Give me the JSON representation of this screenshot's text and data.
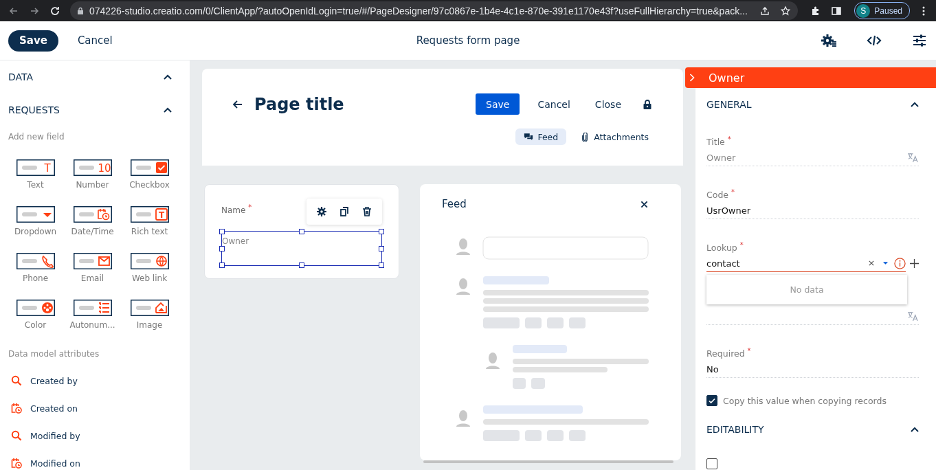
{
  "browser": {
    "url": "074226-studio.creatio.com/0/ClientApp/?autoOpenIdLogin=true/#/PageDesigner/97c0867e-1b4e-4c1e-870e-391e1170e43f?useFullHierarchy=true&pack...",
    "profile_initial": "S",
    "profile_status": "Paused"
  },
  "toolbar": {
    "save": "Save",
    "cancel": "Cancel",
    "title": "Requests form page"
  },
  "left": {
    "data_section": {
      "title": "DATA",
      "expanded": true
    },
    "requests_section": {
      "title": "REQUESTS",
      "expanded": true,
      "add_field_label": "Add new field",
      "field_types": [
        {
          "label": "Text",
          "kind": "text",
          "glyph": "T"
        },
        {
          "label": "Number",
          "kind": "number",
          "glyph": "10"
        },
        {
          "label": "Checkbox",
          "kind": "checkbox"
        },
        {
          "label": "Dropdown",
          "kind": "dropdown"
        },
        {
          "label": "Date/Time",
          "kind": "datetime"
        },
        {
          "label": "Rich text",
          "kind": "richtext",
          "glyph": "T"
        },
        {
          "label": "Phone",
          "kind": "phone"
        },
        {
          "label": "Email",
          "kind": "email"
        },
        {
          "label": "Web link",
          "kind": "weblink"
        },
        {
          "label": "Color",
          "kind": "color"
        },
        {
          "label": "Autonum...",
          "kind": "autonumber"
        },
        {
          "label": "Image",
          "kind": "image"
        }
      ],
      "attributes_label": "Data model attributes",
      "attributes": [
        {
          "label": "Created by",
          "kind": "lookup"
        },
        {
          "label": "Created on",
          "kind": "datetime"
        },
        {
          "label": "Modified by",
          "kind": "lookup"
        },
        {
          "label": "Modified on",
          "kind": "datetime"
        }
      ]
    }
  },
  "canvas": {
    "page_title": "Page title",
    "buttons": [
      {
        "label": "Save",
        "kind": "primary"
      },
      {
        "label": "Cancel",
        "kind": "flat"
      },
      {
        "label": "Close",
        "kind": "flat"
      }
    ],
    "tabs": [
      {
        "label": "Feed",
        "kind": "feed",
        "selected": true
      },
      {
        "label": "Attachments",
        "kind": "attachments",
        "selected": false
      }
    ],
    "form_card": {
      "field": {
        "label": "Name $^{*}$",
        "placeholder": "Owner",
        "selected": true
      }
    },
    "feed_panel": {
      "title": "Feed"
    }
  },
  "properties": {
    "title": "Owner",
    "general": {
      "title": "GENERAL",
      "expanded": true,
      "fields": [
        {
          "kind": "localizable",
          "label": "Title $^{*}$",
          "value": "Owner"
        },
        {
          "kind": "text",
          "label": "Code $^{*}$",
          "value": "UsrOwner"
        },
        {
          "kind": "lookup",
          "label": "Lookup $^{*}$",
          "value": "contact",
          "error": true,
          "dropdown_message": "No data"
        },
        {
          "kind": "localizable"
        },
        {
          "kind": "text",
          "label": "Required $^{*}$",
          "value": "No"
        }
      ],
      "checkbox": {
        "label": "Copy this value when copying records",
        "checked": true
      }
    },
    "editability": {
      "title": "EDITABILITY",
      "expanded": true,
      "checkboxes": [
        {
          "checked": false
        }
      ]
    }
  }
}
